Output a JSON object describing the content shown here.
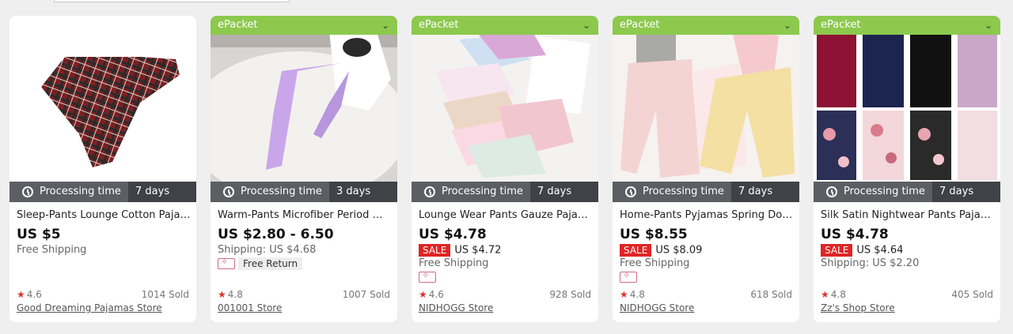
{
  "cards": [
    {
      "epacket": "",
      "processing_label": "Processing time",
      "processing_days": "7 days",
      "title": "Sleep-Pants Lounge Cotton Pajama Pants",
      "price": "US $5",
      "line2": "Free Shipping",
      "rating": "4.6",
      "sold": "1014 Sold",
      "store": "Good Dreaming Pajamas Store",
      "image_icon": "plaid-pants-image"
    },
    {
      "epacket": "ePacket",
      "processing_label": "Processing time",
      "processing_days": "3 days",
      "title": "Warm-Pants Microfiber Period Women Pants",
      "price": "US $2.80 - 6.50",
      "shipping": "Shipping: US $4.68",
      "free_return": "Free Return",
      "rating": "4.8",
      "sold": "1007 Sold",
      "store": "001001 Store",
      "image_icon": "lilac-pants-image"
    },
    {
      "epacket": "ePacket",
      "processing_label": "Processing time",
      "processing_days": "7 days",
      "title": "Lounge Wear Pants Gauze Pajama Shorts",
      "price": "US $4.78",
      "sale_label": "SALE",
      "sale_price": "US $4.72",
      "shipping": "Free Shipping",
      "rating": "4.6",
      "sold": "928 Sold",
      "store": "NIDHOGG Store",
      "image_icon": "print-shorts-image"
    },
    {
      "epacket": "ePacket",
      "processing_label": "Processing time",
      "processing_days": "7 days",
      "title": "Home-Pants Pyjamas Spring Double Gauze",
      "price": "US $8.55",
      "sale_label": "SALE",
      "sale_price": "US $8.09",
      "shipping": "Free Shipping",
      "rating": "4.8",
      "sold": "618 Sold",
      "store": "NIDHOGG Store",
      "image_icon": "pastel-pants-image"
    },
    {
      "epacket": "ePacket",
      "processing_label": "Processing time",
      "processing_days": "7 days",
      "title": "Silk Satin Nightwear Pants Pajama Bottoms",
      "price": "US $4.78",
      "sale_label": "SALE",
      "sale_price": "US $4.64",
      "shipping": "Shipping: US $2.20",
      "rating": "4.8",
      "sold": "405 Sold",
      "store": "Zz's Shop Store",
      "image_icon": "satin-pants-grid-image"
    }
  ],
  "colors": {
    "epacket_green": "#8cc94d",
    "processing_gray": "#5b5e63",
    "sale_red": "#e02424",
    "star_red": "#e03030"
  }
}
